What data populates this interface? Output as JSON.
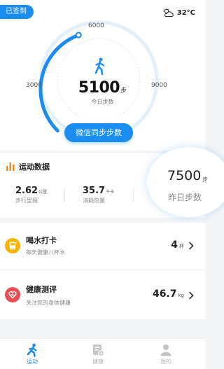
{
  "header": {
    "signin_badge": "已签到",
    "weather_icon": "partly-cloudy-icon",
    "temperature": "32°C"
  },
  "gauge": {
    "tick_3000": "3000",
    "tick_6000": "6000",
    "tick_9000": "9000",
    "progress_steps": 5100,
    "scale_max_steps": 12000,
    "steps": "5100",
    "steps_unit": "步",
    "steps_caption": "今日步数",
    "accent_color": "#1b8cf0"
  },
  "sync_button": "微信同步步数",
  "sport": {
    "title": "运动数据",
    "title_icon": "bar-chart-icon",
    "distance_value": "2.62",
    "distance_unit": "公里",
    "distance_label": "步行里程",
    "calories_value": "35.7",
    "calories_unit": "千卡",
    "calories_label": "消耗热量",
    "yesterday_value": "7500",
    "yesterday_unit": "步",
    "yesterday_label": "昨日步数"
  },
  "water": {
    "icon": "cup-icon",
    "title": "喝水打卡",
    "subtitle": "每天健康八杯水",
    "value": "4",
    "unit": "杯"
  },
  "health": {
    "icon": "heart-icon",
    "title": "健康测评",
    "subtitle": "关注您的身体健康",
    "value": "46.7",
    "unit": "kg"
  },
  "tabs": [
    {
      "label": "运动",
      "icon": "running-icon",
      "active": true
    },
    {
      "label": "健康",
      "icon": "health-report-icon",
      "active": false
    },
    {
      "label": "我的",
      "icon": "user-icon",
      "active": false
    }
  ]
}
